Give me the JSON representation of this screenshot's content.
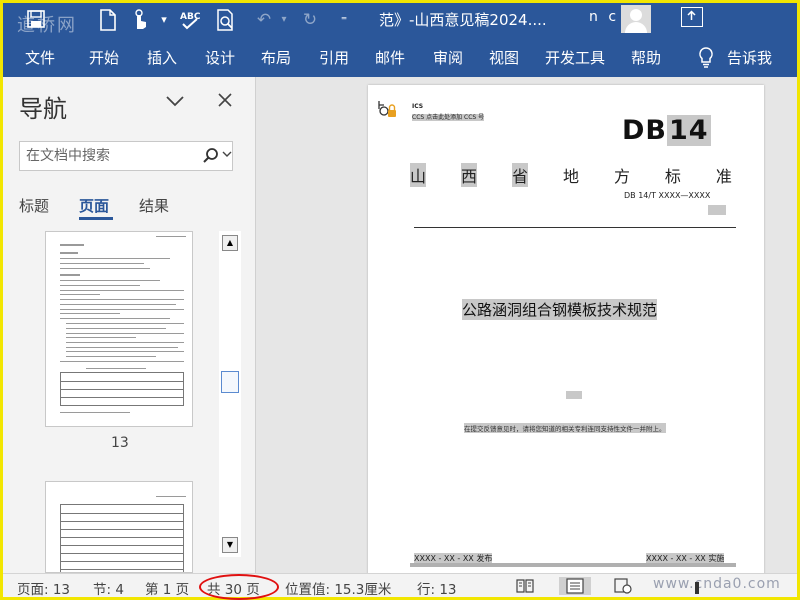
{
  "titlebar": {
    "doc_title": "范》-山西意见稿2024....",
    "user_name": "n c",
    "watermark": "道桥网",
    "quick_access": [
      "save-icon",
      "new-document-icon",
      "touch-mode-icon",
      "spellcheck-icon",
      "print-preview-icon",
      "undo-icon",
      "redo-icon",
      "customize-icon"
    ]
  },
  "ribbon": {
    "tabs": [
      "文件",
      "开始",
      "插入",
      "设计",
      "布局",
      "引用",
      "邮件",
      "审阅",
      "视图",
      "开发工具",
      "帮助"
    ],
    "tell_me": "告诉我",
    "colors": {
      "accent": "#2b579a"
    }
  },
  "nav": {
    "title": "导航",
    "search_placeholder": "在文档中搜索",
    "tabs": [
      "标题",
      "页面",
      "结果"
    ],
    "active_tab": "页面",
    "page_label": "13"
  },
  "document": {
    "ics": "ICS",
    "ccs": "CCS 点击此处添加 CCS 号",
    "db_prefix": "DB",
    "db_number": "14",
    "province_chars": [
      "山",
      "西",
      "省",
      "地",
      "方",
      "标",
      "准"
    ],
    "std_no": "DB 14/T  XXXX—XXXX",
    "title": "公路涵洞组合钢模板技术规范",
    "note": "在提交反馈意见时，请将您知道的相关专利连同支持性文件一并附上。",
    "release": "XXXX - XX - XX 发布",
    "implement": "XXXX - XX - XX 实施"
  },
  "statusbar": {
    "page": "页面: 13",
    "section": "节: 4",
    "page_of": "第 1 页",
    "total": "共 30 页",
    "position": "位置值: 15.3厘米",
    "line": "行: 13",
    "site": "www.cnda0.com"
  }
}
